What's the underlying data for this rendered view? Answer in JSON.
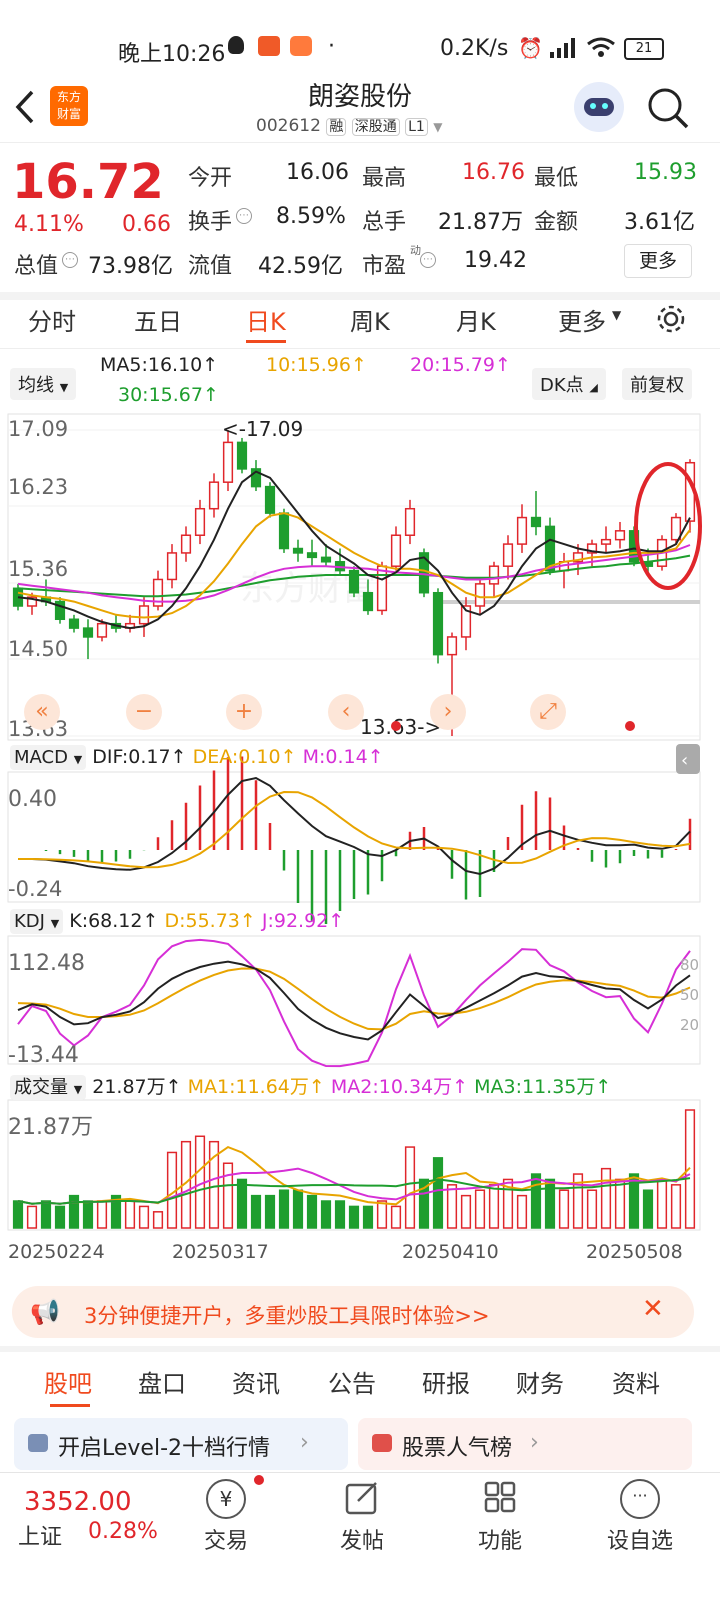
{
  "status": {
    "time": "晚上10:26",
    "dot": "·",
    "net": "0.2K/s",
    "battery": "21"
  },
  "header": {
    "title": "朗姿股份",
    "code": "002612",
    "tag_margin": "融",
    "tag_connect": "深股通",
    "tag_level": "L1",
    "logo_line1": "东方",
    "logo_line2": "财富"
  },
  "quote": {
    "price": "16.72",
    "pct": "4.11%",
    "change": "0.66",
    "open_label": "今开",
    "open": "16.06",
    "high_label": "最高",
    "high": "16.76",
    "low_label": "最低",
    "low": "15.93",
    "turnover_label": "换手",
    "turnover": "8.59%",
    "volume_label": "总手",
    "volume": "21.87万",
    "amount_label": "金额",
    "amount": "3.61亿",
    "mktcap_label": "总值",
    "mktcap": "73.98亿",
    "float_label": "流值",
    "float_cap": "42.59亿",
    "pe_label": "市盈",
    "pe_sup": "动",
    "pe": "19.42",
    "more": "更多"
  },
  "tabs": [
    "分时",
    "五日",
    "日K",
    "周K",
    "月K",
    "更多"
  ],
  "active_tab": "日K",
  "ma_bar": {
    "selector": "均线",
    "ma5": "MA5:16.10",
    "ma10": "10:15.96",
    "ma20": "20:15.79",
    "ma30": "30:15.67",
    "dk": "DK点",
    "adjust": "前复权"
  },
  "kline": {
    "y_top": "17.09",
    "y_2": "16.23",
    "y_3": "15.36",
    "y_4": "14.50",
    "y_bottom": "13.63",
    "max_label": "<-17.09",
    "min_label": "13.63->",
    "watermark": "东方财富"
  },
  "macd": {
    "selector": "MACD",
    "dif": "DIF:0.17",
    "dea": "DEA:0.10",
    "m": "M:0.14",
    "y_top": "0.40",
    "y_bottom": "-0.24"
  },
  "kdj": {
    "selector": "KDJ",
    "k": "K:68.12",
    "d": "D:55.73",
    "j": "J:92.92",
    "y_top": "112.48",
    "y_bottom": "-13.44",
    "lvl80": "80",
    "lvl50": "50",
    "lvl20": "20"
  },
  "volume": {
    "selector": "成交量",
    "value": "21.87万",
    "ma1": "MA1:11.64万",
    "ma2": "MA2:10.34万",
    "ma3": "MA3:11.35万",
    "y_top": "21.87万"
  },
  "dates": [
    "20250224",
    "20250317",
    "20250410",
    "20250508"
  ],
  "promo": {
    "text": "3分钟便捷开户，多重炒股工具限时体验>>"
  },
  "section_tabs": [
    "股吧",
    "盘口",
    "资讯",
    "公告",
    "研报",
    "财务",
    "资料"
  ],
  "cards": [
    {
      "title": "开启Level-2十档行情"
    },
    {
      "title": "股票人气榜"
    }
  ],
  "bottom": {
    "index_value": "3352.00",
    "index_name": "上证",
    "index_pct": "0.28%",
    "items": [
      "交易",
      "发帖",
      "功能",
      "设自选"
    ]
  },
  "colors": {
    "up": "#e0262b",
    "down": "#1e9e2e",
    "ma10": "#e8a400",
    "ma20": "#d62fd6",
    "ma30": "#1e9e2e",
    "accent": "#f04a1e"
  },
  "chart_data": {
    "type": "candlestick",
    "candles": [
      [
        15.3,
        15.35,
        15.05,
        15.1
      ],
      [
        15.1,
        15.25,
        15.0,
        15.2
      ],
      [
        15.2,
        15.4,
        15.1,
        15.15
      ],
      [
        15.15,
        15.2,
        14.9,
        14.95
      ],
      [
        14.95,
        15.0,
        14.8,
        14.85
      ],
      [
        14.85,
        14.95,
        14.5,
        14.75
      ],
      [
        14.75,
        14.95,
        14.7,
        14.9
      ],
      [
        14.9,
        15.0,
        14.8,
        14.85
      ],
      [
        14.85,
        15.0,
        14.8,
        14.9
      ],
      [
        14.9,
        15.2,
        14.75,
        15.1
      ],
      [
        15.1,
        15.5,
        15.05,
        15.4
      ],
      [
        15.4,
        15.8,
        15.3,
        15.7
      ],
      [
        15.7,
        16.0,
        15.6,
        15.9
      ],
      [
        15.9,
        16.3,
        15.8,
        16.2
      ],
      [
        16.2,
        16.6,
        16.1,
        16.5
      ],
      [
        16.5,
        17.09,
        16.4,
        16.95
      ],
      [
        16.95,
        17.0,
        16.6,
        16.65
      ],
      [
        16.65,
        16.75,
        16.4,
        16.45
      ],
      [
        16.45,
        16.5,
        16.1,
        16.15
      ],
      [
        16.15,
        16.2,
        15.7,
        15.75
      ],
      [
        15.75,
        15.85,
        15.6,
        15.7
      ],
      [
        15.7,
        15.85,
        15.55,
        15.65
      ],
      [
        15.65,
        15.8,
        15.55,
        15.6
      ],
      [
        15.6,
        15.75,
        15.45,
        15.5
      ],
      [
        15.5,
        15.55,
        15.2,
        15.25
      ],
      [
        15.25,
        15.4,
        15.0,
        15.05
      ],
      [
        15.05,
        15.6,
        15.0,
        15.55
      ],
      [
        15.55,
        16.0,
        15.5,
        15.9
      ],
      [
        15.9,
        16.3,
        15.8,
        16.2
      ],
      [
        15.7,
        15.75,
        15.2,
        15.25
      ],
      [
        15.25,
        15.3,
        14.45,
        14.55
      ],
      [
        14.55,
        14.8,
        13.63,
        14.75
      ],
      [
        14.75,
        15.2,
        14.6,
        15.1
      ],
      [
        15.1,
        15.4,
        15.0,
        15.35
      ],
      [
        15.35,
        15.6,
        15.2,
        15.55
      ],
      [
        15.55,
        15.9,
        15.4,
        15.8
      ],
      [
        15.8,
        16.25,
        15.7,
        16.1
      ],
      [
        16.1,
        16.4,
        15.9,
        16.0
      ],
      [
        16.0,
        16.1,
        15.45,
        15.5
      ],
      [
        15.5,
        15.7,
        15.3,
        15.6
      ],
      [
        15.6,
        15.8,
        15.45,
        15.7
      ],
      [
        15.7,
        15.85,
        15.55,
        15.8
      ],
      [
        15.8,
        16.0,
        15.7,
        15.85
      ],
      [
        15.85,
        16.05,
        15.75,
        15.95
      ],
      [
        15.95,
        16.0,
        15.55,
        15.6
      ],
      [
        15.6,
        15.75,
        15.45,
        15.55
      ],
      [
        15.55,
        15.9,
        15.5,
        15.85
      ],
      [
        15.85,
        16.15,
        15.8,
        16.1
      ],
      [
        16.06,
        16.76,
        15.93,
        16.72
      ]
    ],
    "ma5": [
      15.2,
      15.18,
      15.15,
      15.1,
      15.05,
      14.98,
      14.92,
      14.88,
      14.85,
      14.87,
      14.95,
      15.1,
      15.3,
      15.55,
      15.85,
      16.2,
      16.5,
      16.62,
      16.55,
      16.35,
      16.15,
      15.95,
      15.78,
      15.68,
      15.58,
      15.45,
      15.4,
      15.48,
      15.62,
      15.65,
      15.5,
      15.25,
      15.05,
      15.0,
      15.1,
      15.3,
      15.55,
      15.75,
      15.85,
      15.8,
      15.75,
      15.72,
      15.7,
      15.72,
      15.75,
      15.72,
      15.72,
      15.8,
      16.1
    ],
    "ma10": [
      15.25,
      15.22,
      15.2,
      15.18,
      15.15,
      15.1,
      15.05,
      15.0,
      14.98,
      14.97,
      14.98,
      15.02,
      15.1,
      15.22,
      15.38,
      15.58,
      15.8,
      16.0,
      16.12,
      16.15,
      16.1,
      16.0,
      15.9,
      15.8,
      15.7,
      15.62,
      15.55,
      15.52,
      15.52,
      15.5,
      15.45,
      15.35,
      15.25,
      15.2,
      15.2,
      15.25,
      15.35,
      15.45,
      15.55,
      15.6,
      15.62,
      15.65,
      15.66,
      15.68,
      15.7,
      15.7,
      15.71,
      15.75,
      15.96
    ],
    "ma20": [
      15.35,
      15.33,
      15.31,
      15.29,
      15.27,
      15.25,
      15.22,
      15.2,
      15.18,
      15.16,
      15.15,
      15.15,
      15.16,
      15.18,
      15.22,
      15.28,
      15.35,
      15.42,
      15.48,
      15.52,
      15.54,
      15.55,
      15.55,
      15.54,
      15.53,
      15.52,
      15.5,
      15.48,
      15.47,
      15.46,
      15.44,
      15.42,
      15.4,
      15.4,
      15.41,
      15.43,
      15.46,
      15.5,
      15.53,
      15.56,
      15.58,
      15.6,
      15.62,
      15.64,
      15.66,
      15.68,
      15.7,
      15.73,
      15.79
    ],
    "ma30": [
      15.3,
      15.29,
      15.28,
      15.27,
      15.26,
      15.25,
      15.24,
      15.23,
      15.22,
      15.21,
      15.21,
      15.22,
      15.23,
      15.25,
      15.27,
      15.3,
      15.33,
      15.36,
      15.39,
      15.41,
      15.43,
      15.44,
      15.45,
      15.45,
      15.45,
      15.45,
      15.45,
      15.45,
      15.45,
      15.45,
      15.44,
      15.43,
      15.42,
      15.42,
      15.42,
      15.43,
      15.44,
      15.46,
      15.48,
      15.5,
      15.52,
      15.54,
      15.55,
      15.57,
      15.58,
      15.6,
      15.62,
      15.64,
      15.67
    ],
    "volume": [
      5,
      4,
      5,
      4,
      6,
      5,
      5,
      6,
      5,
      4,
      3,
      14,
      16,
      17,
      16,
      12,
      9,
      6,
      6,
      7,
      7,
      6,
      5,
      5,
      4,
      4,
      5,
      4,
      15,
      9,
      13,
      8,
      6,
      7,
      8,
      9,
      6,
      10,
      9,
      7,
      10,
      7,
      11,
      9,
      10,
      7,
      9,
      8,
      21.87
    ]
  }
}
